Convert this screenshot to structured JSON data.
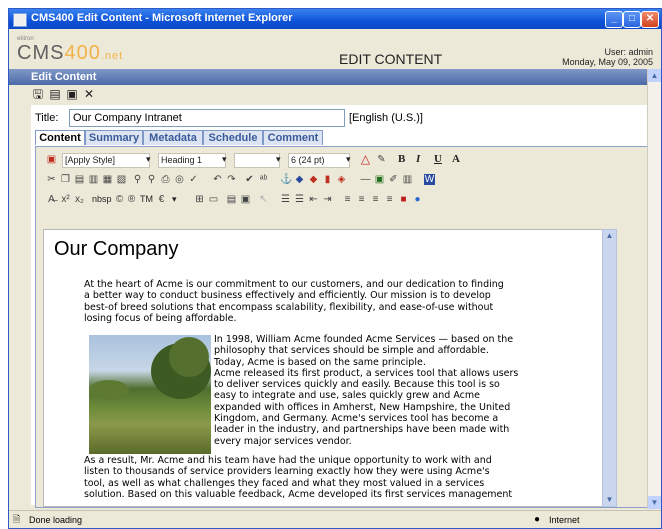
{
  "window": {
    "title": "CMS400 Edit Content - Microsoft Internet Explorer"
  },
  "header": {
    "logo_prefix": "CMS",
    "logo_number": "400",
    "logo_suffix": ".net",
    "logo_tag": "ektron",
    "title": "EDIT CONTENT",
    "user": "User: admin",
    "date": "Monday, May 09, 2005"
  },
  "panel": {
    "title": "Edit Content"
  },
  "actions": [
    {
      "icon": "save-icon"
    },
    {
      "icon": "publish-icon"
    },
    {
      "icon": "checkin-icon"
    },
    {
      "icon": "close-icon",
      "glyph": "✕"
    }
  ],
  "form": {
    "title_label": "Title:",
    "title_value": "Our Company Intranet",
    "language": "[English (U.S.)]"
  },
  "tabs": [
    "Content",
    "Summary",
    "Metadata",
    "Schedule",
    "Comment"
  ],
  "toolbar": {
    "style": "[Apply Style]",
    "heading": "Heading 1",
    "font_size": "6 (24 pt)",
    "bold": "B",
    "italic": "I",
    "underline": "U",
    "font_color": "A",
    "nbsp": "nbsp",
    "tm": "TM"
  },
  "document": {
    "heading": "Our Company",
    "para1": [
      "At the heart of Acme is our commitment to our customers, and our dedication to finding",
      "a better way to conduct business effectively and efficiently. Our mission is to develop",
      "best-of breed solutions that encompass scalability, flexibility, and ease-of-use without",
      "losing focus of being affordable."
    ],
    "para2": [
      " In 1998, William Acme founded Acme Services — based on the",
      "philosophy that services should be simple and affordable.",
      "Today, Acme is based on the same principle.",
      "Acme released its first product, a services tool that allows users",
      "to deliver services quickly and easily.  Because this tool is so",
      "easy to integrate and use, sales quickly grew and Acme",
      "expanded with offices in Amherst, New Hampshire, the United",
      "Kingdom, and Germany. Acme's services tool has become a",
      "leader in the industry, and partnerships have been made with",
      "every major services vendor."
    ],
    "para3": [
      "As a result, Mr. Acme and his team have had the unique opportunity to work with and",
      "listen to thousands of service providers learning exactly how they were using Acme's",
      "tool, as well as what challenges they faced and what they most valued in a services",
      "solution. Based on this valuable feedback, Acme developed its first services management"
    ]
  },
  "status": {
    "text": "Done loading",
    "zone": "Internet"
  }
}
